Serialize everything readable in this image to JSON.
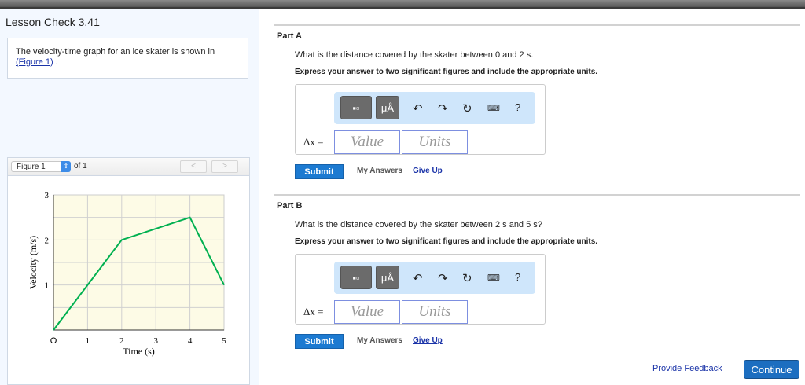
{
  "lesson_title": "Lesson Check 3.41",
  "intro": {
    "text": "The velocity-time graph for an ice skater is shown in",
    "link": "(Figure 1)",
    "after": " ."
  },
  "figure": {
    "select_value": "Figure 1",
    "of_label": "of 1",
    "prev": "<",
    "next": ">"
  },
  "chart_data": {
    "type": "line",
    "xlabel": "Time (s)",
    "ylabel": "Velocity (m/s)",
    "x_ticks": [
      "O",
      "1",
      "2",
      "3",
      "4",
      "5"
    ],
    "y_ticks": [
      "1",
      "2",
      "3"
    ],
    "xlim": [
      0,
      5
    ],
    "ylim": [
      0,
      3
    ],
    "grid": true,
    "series": [
      {
        "name": "velocity",
        "x": [
          0,
          2,
          4,
          5
        ],
        "y": [
          0,
          2,
          2.5,
          1
        ],
        "color": "#00b050"
      }
    ]
  },
  "parts": [
    {
      "label": "Part A",
      "question": "What is the distance covered by the skater between 0 and 2 s.",
      "instruction": "Express your answer to two significant figures and include the appropriate units.",
      "var": "Δx =",
      "value_placeholder": "Value",
      "units_placeholder": "Units",
      "submit": "Submit",
      "my_answers": "My Answers",
      "give_up": "Give Up"
    },
    {
      "label": "Part B",
      "question": "What is the distance covered by the skater between 2 s and 5 s?",
      "instruction": "Express your answer to two significant figures and include the appropriate units.",
      "var": "Δx =",
      "value_placeholder": "Value",
      "units_placeholder": "Units",
      "submit": "Submit",
      "my_answers": "My Answers",
      "give_up": "Give Up"
    }
  ],
  "toolbar": {
    "units_btn": "μÅ",
    "help": "?"
  },
  "footer": {
    "feedback": "Provide Feedback",
    "continue": "Continue"
  }
}
